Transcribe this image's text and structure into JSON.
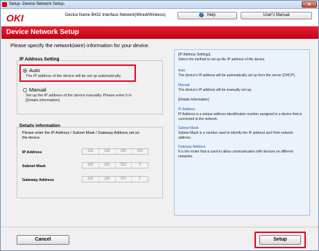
{
  "window": {
    "title": "Setup -Device Network Setup-",
    "close_label": "x"
  },
  "header": {
    "logo": "OKI",
    "device_name": "Device Name B432 Interface Network(Wired/Wireless)",
    "help_label": "Help",
    "manual_label": "User's Manual"
  },
  "banner": {
    "title": "Device Network Setup"
  },
  "instruction": "Please specify the network(wire) information for your device.",
  "ip_setting": {
    "label": "IP Address Setting",
    "auto_label": "Auto",
    "auto_desc": "The IP address of the device will be set up automatically.",
    "manual_label": "Manual",
    "manual_desc": "Set up the IP address of the device manually. Please enter it in [Details information].",
    "selected": "Auto"
  },
  "details": {
    "label": "Details information",
    "text": "Please enter the IP Address / Subnet Mask / Gateway Address set on the device.",
    "fields": [
      {
        "label": "IP Address",
        "octets": [
          "192",
          "168",
          "205",
          "230"
        ]
      },
      {
        "label": "Subnet Mask",
        "octets": [
          "255",
          "255",
          "252",
          "0"
        ]
      },
      {
        "label": "Gateway Address",
        "octets": [
          "192",
          "168",
          "222",
          "1"
        ]
      }
    ]
  },
  "help_pane": {
    "section_title": "[IP Address Settings]",
    "section_text": "Select the method to set up the IP address of the device.",
    "auto_title": "Auto",
    "auto_text": "The device's IP address will be automatically set up from the server (DHCP).",
    "manual_title": "Manual",
    "manual_text": "The device's IP address will be manually set up.",
    "details_title": "[Details Information]",
    "ip_title": "IP Address",
    "ip_text": "IP Address is a unique address identification number assigned to a device that is connected to the network.",
    "subnet_title": "Subnet Mask",
    "subnet_text": "Subnet Mask is a number used to identify the IP address and Host network address.",
    "gateway_title": "Gateway Address",
    "gateway_text": "It is the router that is used to allow communication with devices on different networks."
  },
  "footer": {
    "cancel_label": "Cancel",
    "setup_label": "Setup"
  },
  "colors": {
    "brand_red": "#d6001c",
    "highlight": "#e8001b",
    "help_bg": "#eaf3fb",
    "link_blue": "#1f58b5"
  }
}
